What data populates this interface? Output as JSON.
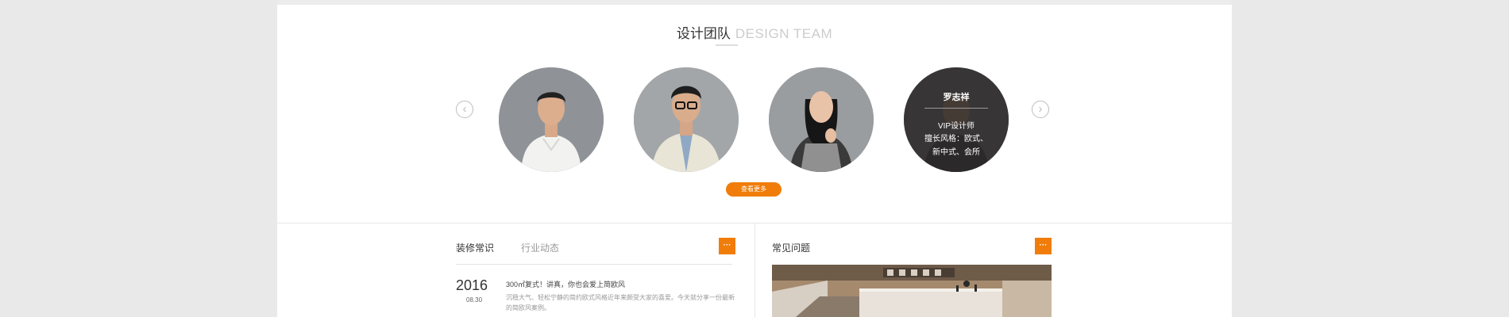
{
  "team": {
    "title_cn": "设计团队",
    "title_en": "DESIGN TEAM",
    "prev_arrow": "‹",
    "next_arrow": "›",
    "hovered_member": {
      "name": "罗志祥",
      "role": "VIP设计师",
      "specialty": "擅长风格：欧式、新中式、会所"
    },
    "more_button": "查看更多"
  },
  "news": {
    "tabs": [
      "装修常识",
      "行业动态"
    ],
    "more_icon": "···",
    "item": {
      "year": "2016",
      "date": "08.30",
      "title": "300㎡复式！讲真，你也会爱上简欧风",
      "excerpt": "沉稳大气、轻松宁静的简约欧式风格近年来颇受大家的喜爱。今天就分享一份最新的简欧风案例。"
    }
  },
  "faq": {
    "title": "常见问题",
    "more_icon": "···"
  },
  "colors": {
    "accent": "#f07d0a",
    "page_bg": "#e9e9e9",
    "panel_bg": "#ffffff"
  }
}
